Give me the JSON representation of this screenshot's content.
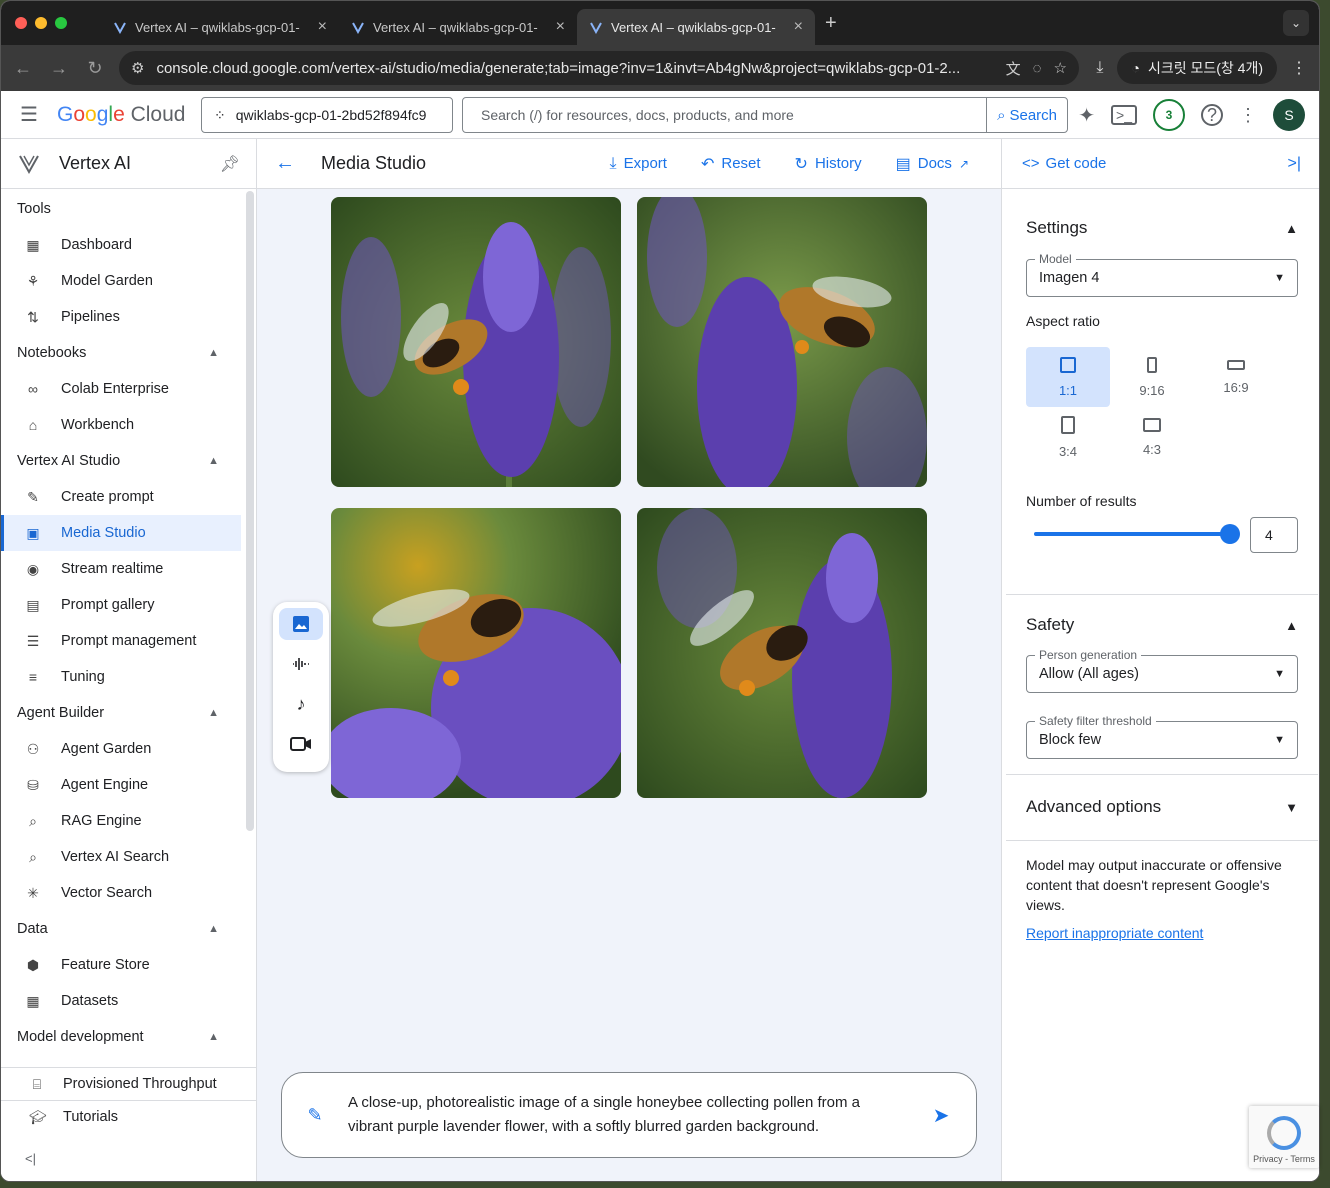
{
  "browser": {
    "tabs": [
      {
        "title": "Vertex AI – qwiklabs-gcp-01-",
        "active": false
      },
      {
        "title": "Vertex AI – qwiklabs-gcp-01-",
        "active": false
      },
      {
        "title": "Vertex AI – qwiklabs-gcp-01-",
        "active": true
      }
    ],
    "url": "console.cloud.google.com/vertex-ai/studio/media/generate;tab=image?inv=1&invt=Ab4gNw&project=qwiklabs-gcp-01-2...",
    "incognito_label": "시크릿 모드(창 4개)"
  },
  "header": {
    "logo": "Google Cloud",
    "project": "qwiklabs-gcp-01-2bd52f894fc9",
    "search_placeholder": "Search (/) for resources, docs, products, and more",
    "search_button": "Search",
    "notifications_count": "3",
    "avatar_initial": "S"
  },
  "sidebar": {
    "product": "Vertex AI",
    "sections": [
      {
        "title": "Tools",
        "collapsible": false,
        "items": [
          {
            "label": "Dashboard",
            "icon": "dashboard-icon"
          },
          {
            "label": "Model Garden",
            "icon": "sprout-icon"
          },
          {
            "label": "Pipelines",
            "icon": "pipelines-icon"
          }
        ]
      },
      {
        "title": "Notebooks",
        "collapsible": true,
        "items": [
          {
            "label": "Colab Enterprise",
            "icon": "colab-icon"
          },
          {
            "label": "Workbench",
            "icon": "workbench-icon"
          }
        ]
      },
      {
        "title": "Vertex AI Studio",
        "collapsible": true,
        "items": [
          {
            "label": "Create prompt",
            "icon": "magic-pen-icon"
          },
          {
            "label": "Media Studio",
            "icon": "media-icon",
            "active": true
          },
          {
            "label": "Stream realtime",
            "icon": "stream-icon"
          },
          {
            "label": "Prompt gallery",
            "icon": "gallery-icon"
          },
          {
            "label": "Prompt management",
            "icon": "list-icon"
          },
          {
            "label": "Tuning",
            "icon": "tune-icon"
          }
        ]
      },
      {
        "title": "Agent Builder",
        "collapsible": true,
        "items": [
          {
            "label": "Agent Garden",
            "icon": "agent-garden-icon"
          },
          {
            "label": "Agent Engine",
            "icon": "agent-engine-icon"
          },
          {
            "label": "RAG Engine",
            "icon": "rag-icon"
          },
          {
            "label": "Vertex AI Search",
            "icon": "search-icon"
          },
          {
            "label": "Vector Search",
            "icon": "vector-icon"
          }
        ]
      },
      {
        "title": "Data",
        "collapsible": true,
        "items": [
          {
            "label": "Feature Store",
            "icon": "feature-store-icon"
          },
          {
            "label": "Datasets",
            "icon": "datasets-icon"
          }
        ]
      },
      {
        "title": "Model development",
        "collapsible": true,
        "items": []
      }
    ],
    "bottom_items": [
      {
        "label": "Provisioned Throughput",
        "icon": "throughput-icon"
      },
      {
        "label": "Tutorials",
        "icon": "tutorials-icon"
      }
    ]
  },
  "main": {
    "title": "Media Studio",
    "actions": {
      "export": "Export",
      "reset": "Reset",
      "history": "History",
      "docs": "Docs"
    },
    "prompt_text": "A close-up, photorealistic image of a single honeybee collecting pollen from a vibrant purple lavender flower, with a softly blurred garden background."
  },
  "right_panel": {
    "get_code": "Get code",
    "settings": {
      "title": "Settings",
      "model_label": "Model",
      "model_value": "Imagen 4",
      "aspect_ratio_label": "Aspect ratio",
      "aspect_ratios": [
        "1:1",
        "9:16",
        "16:9",
        "3:4",
        "4:3"
      ],
      "aspect_selected": "1:1",
      "results_label": "Number of results",
      "results_value": "4"
    },
    "safety": {
      "title": "Safety",
      "person_label": "Person generation",
      "person_value": "Allow (All ages)",
      "filter_label": "Safety filter threshold",
      "filter_value": "Block few"
    },
    "advanced": {
      "title": "Advanced options"
    },
    "disclaimer": "Model may output inaccurate or offensive content that doesn't represent Google's views.",
    "report_link": "Report inappropriate content"
  },
  "recaptcha": {
    "text": "Privacy - Terms"
  },
  "colors": {
    "accent": "#1a73e8",
    "active_bg": "#e8f0fe",
    "lavender": "#7b5cc6"
  }
}
